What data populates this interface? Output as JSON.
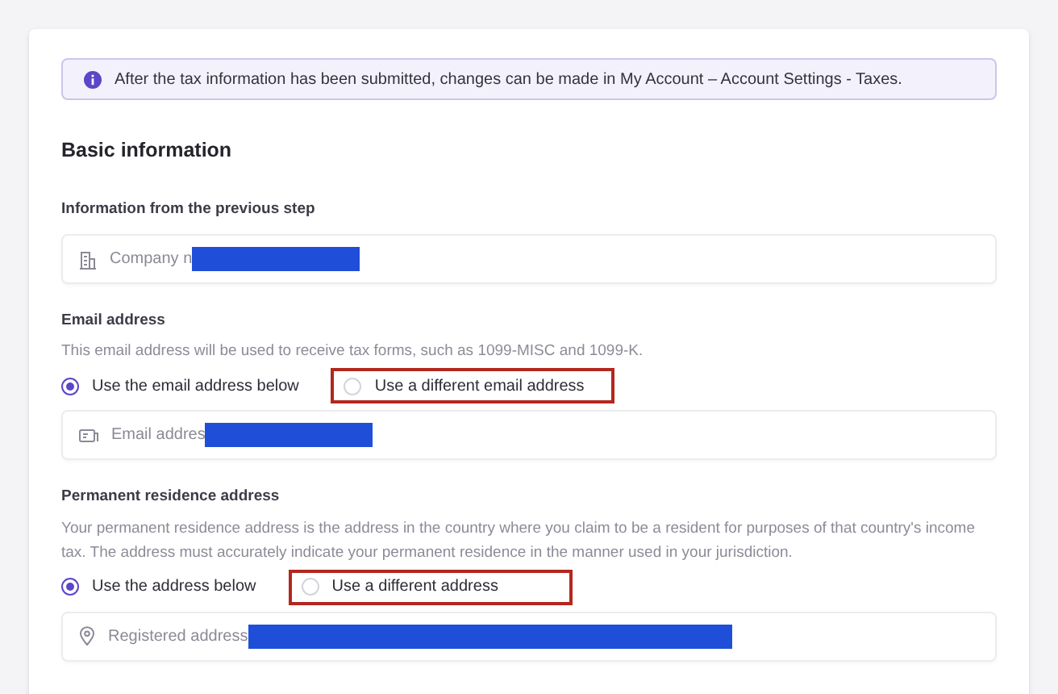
{
  "notice": "After the tax information has been submitted, changes can be made in My Account – Account Settings - Taxes.",
  "heading": "Basic information",
  "sections": [
    {
      "title": "Information from the previous step",
      "field": {
        "text": "Company n",
        "redacted": true
      }
    },
    {
      "title": "Email address",
      "description": "This email address will be used to receive tax forms, such as 1099-MISC and 1099-K.",
      "options": [
        {
          "label": "Use the email address below",
          "selected": true,
          "highlighted": false
        },
        {
          "label": "Use a different email address",
          "selected": false,
          "highlighted": true
        }
      ],
      "field": {
        "text": "Email addres",
        "redacted": true
      }
    },
    {
      "title": "Permanent residence address",
      "description": "Your permanent residence address is the address in the country where you claim to be a resident for purposes of that country's income tax. The address must accurately indicate your permanent residence in the manner used in your jurisdiction.",
      "options": [
        {
          "label": "Use the address below",
          "selected": true,
          "highlighted": false
        },
        {
          "label": "Use a different address",
          "selected": false,
          "highlighted": true
        }
      ],
      "field": {
        "text": "Registered address",
        "redacted": true
      }
    }
  ]
}
